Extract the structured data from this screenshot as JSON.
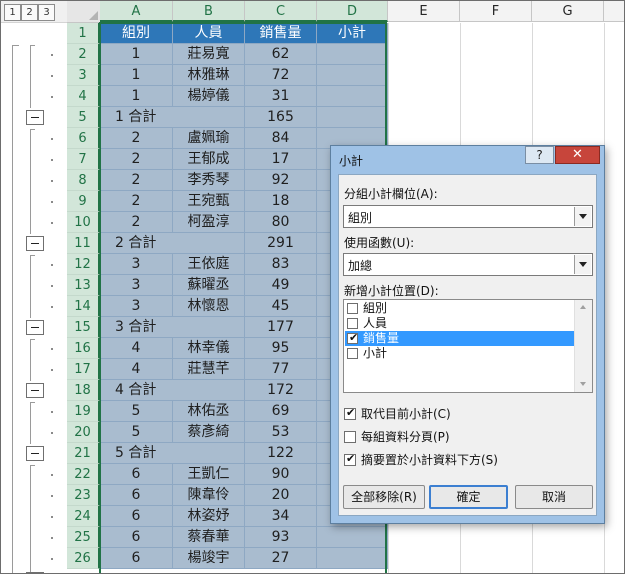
{
  "outline": {
    "levels": [
      "1",
      "2",
      "3"
    ]
  },
  "columns": [
    "A",
    "B",
    "C",
    "D",
    "E",
    "F",
    "G"
  ],
  "rows": [
    {
      "n": "1",
      "type": "hdr",
      "a": "組別",
      "b": "人員",
      "c": "銷售量",
      "d": "小計"
    },
    {
      "n": "2",
      "type": "data",
      "a": "1",
      "b": "莊易寬",
      "c": "62"
    },
    {
      "n": "3",
      "type": "data",
      "a": "1",
      "b": "林雅琳",
      "c": "72"
    },
    {
      "n": "4",
      "type": "data",
      "a": "1",
      "b": "楊婷儀",
      "c": "31"
    },
    {
      "n": "5",
      "type": "sub",
      "a": "1 合計",
      "c": "165"
    },
    {
      "n": "6",
      "type": "data",
      "a": "2",
      "b": "盧姵瑜",
      "c": "84"
    },
    {
      "n": "7",
      "type": "data",
      "a": "2",
      "b": "王郁成",
      "c": "17"
    },
    {
      "n": "8",
      "type": "data",
      "a": "2",
      "b": "李秀琴",
      "c": "92"
    },
    {
      "n": "9",
      "type": "data",
      "a": "2",
      "b": "王宛甄",
      "c": "18"
    },
    {
      "n": "10",
      "type": "data",
      "a": "2",
      "b": "柯盈淳",
      "c": "80"
    },
    {
      "n": "11",
      "type": "sub",
      "a": "2 合計",
      "c": "291"
    },
    {
      "n": "12",
      "type": "data",
      "a": "3",
      "b": "王依庭",
      "c": "83"
    },
    {
      "n": "13",
      "type": "data",
      "a": "3",
      "b": "蘇曜丞",
      "c": "49"
    },
    {
      "n": "14",
      "type": "data",
      "a": "3",
      "b": "林懷恩",
      "c": "45"
    },
    {
      "n": "15",
      "type": "sub",
      "a": "3 合計",
      "c": "177"
    },
    {
      "n": "16",
      "type": "data",
      "a": "4",
      "b": "林幸儀",
      "c": "95"
    },
    {
      "n": "17",
      "type": "data",
      "a": "4",
      "b": "莊慧芊",
      "c": "77"
    },
    {
      "n": "18",
      "type": "sub",
      "a": "4 合計",
      "c": "172"
    },
    {
      "n": "19",
      "type": "data",
      "a": "5",
      "b": "林佑丞",
      "c": "69"
    },
    {
      "n": "20",
      "type": "data",
      "a": "5",
      "b": "蔡彥綺",
      "c": "53"
    },
    {
      "n": "21",
      "type": "sub",
      "a": "5 合計",
      "c": "122"
    },
    {
      "n": "22",
      "type": "data",
      "a": "6",
      "b": "王凱仁",
      "c": "90"
    },
    {
      "n": "23",
      "type": "data",
      "a": "6",
      "b": "陳韋伶",
      "c": "20"
    },
    {
      "n": "24",
      "type": "data",
      "a": "6",
      "b": "林姿妤",
      "c": "34"
    },
    {
      "n": "25",
      "type": "data",
      "a": "6",
      "b": "蔡春華",
      "c": "93"
    },
    {
      "n": "26",
      "type": "data",
      "a": "6",
      "b": "楊竣宇",
      "c": "27"
    }
  ],
  "dialog": {
    "title": "小計",
    "help": "?",
    "close": "✕",
    "group_label": "分組小計欄位(A):",
    "group_value": "組別",
    "func_label": "使用函數(U):",
    "func_value": "加總",
    "add_label": "新增小計位置(D):",
    "fields": [
      {
        "label": "組別",
        "checked": false,
        "selected": false
      },
      {
        "label": "人員",
        "checked": false,
        "selected": false
      },
      {
        "label": "銷售量",
        "checked": true,
        "selected": true
      },
      {
        "label": "小計",
        "checked": false,
        "selected": false
      }
    ],
    "options": [
      {
        "label": "取代目前小計(C)",
        "checked": true
      },
      {
        "label": "每組資料分頁(P)",
        "checked": false
      },
      {
        "label": "摘要置於小計資料下方(S)",
        "checked": true
      }
    ],
    "buttons": {
      "remove": "全部移除(R)",
      "ok": "確定",
      "cancel": "取消"
    }
  }
}
